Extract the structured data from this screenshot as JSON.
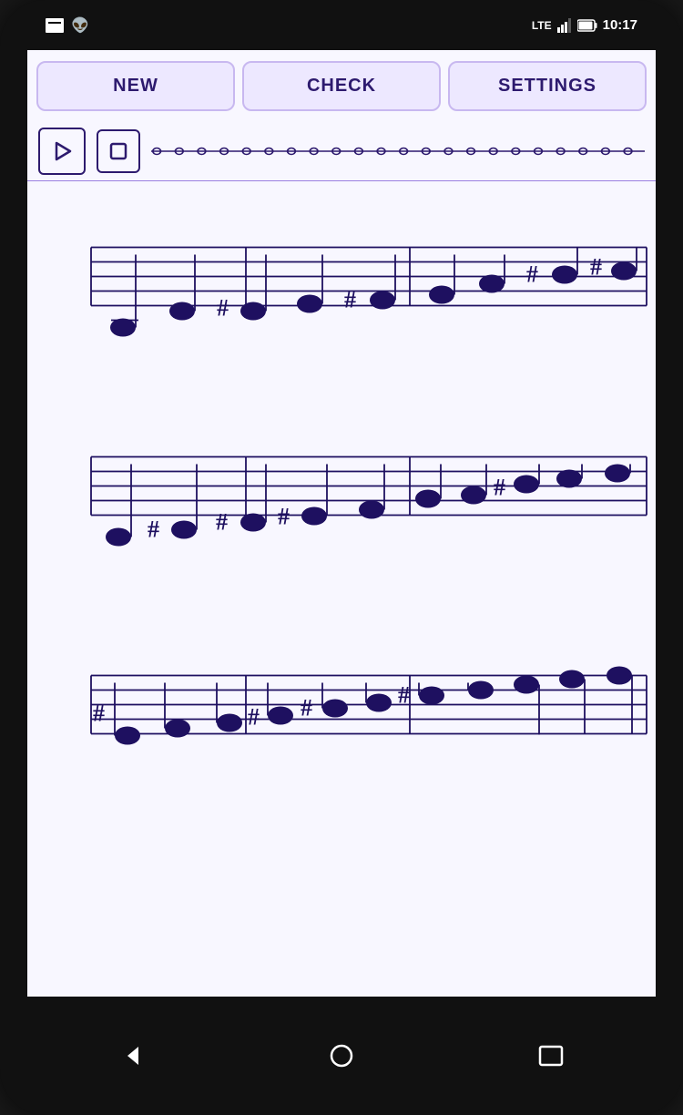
{
  "status_bar": {
    "time": "10:17",
    "lte_label": "LTE",
    "battery_level": 85
  },
  "top_buttons": {
    "new_label": "NEW",
    "check_label": "CHECK",
    "settings_label": "SETTINGS"
  },
  "playback": {
    "play_icon": "play-icon",
    "stop_icon": "stop-icon"
  },
  "nav": {
    "back_icon": "back-icon",
    "home_icon": "home-icon",
    "recents_icon": "recents-icon"
  }
}
